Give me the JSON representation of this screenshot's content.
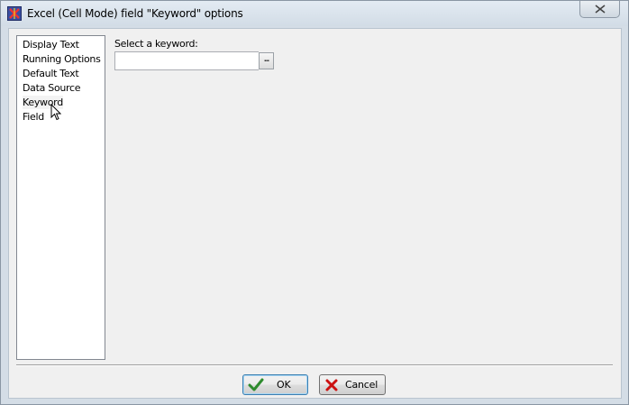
{
  "window": {
    "title": "Excel (Cell Mode) field \"Keyword\" options"
  },
  "nav": {
    "items": [
      {
        "label": "Display Text"
      },
      {
        "label": "Running Options"
      },
      {
        "label": "Default Text"
      },
      {
        "label": "Data Source"
      },
      {
        "label": "Keyword"
      },
      {
        "label": "Field"
      }
    ]
  },
  "keyword": {
    "label": "Select a keyword:",
    "value": "",
    "browse_label": "..."
  },
  "buttons": {
    "ok_label": "OK",
    "cancel_label": "Cancel"
  },
  "icons": {
    "app": "app-logo-icon",
    "close": "close-icon",
    "ok": "checkmark-icon",
    "cancel": "x-icon",
    "cursor": "mouse-pointer-icon"
  },
  "colors": {
    "ok_check": "#2e8b2e",
    "cancel_x": "#cc1111"
  }
}
